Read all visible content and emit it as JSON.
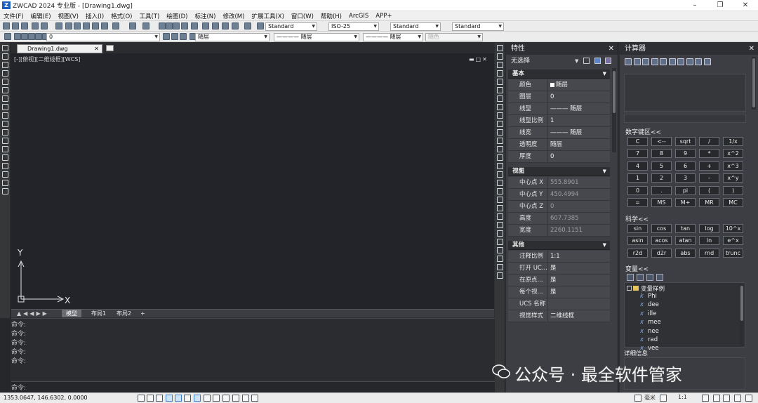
{
  "window": {
    "title": "ZWCAD 2024 专业版 - [Drawing1.dwg]",
    "logo": "Z"
  },
  "menu": [
    "文件(F)",
    "编辑(E)",
    "视图(V)",
    "插入(I)",
    "格式(O)",
    "工具(T)",
    "绘图(D)",
    "标注(N)",
    "修改(M)",
    "扩展工具(X)",
    "窗口(W)",
    "帮助(H)",
    "ArcGIS",
    "APP+"
  ],
  "toolbar": {
    "text_style": "Standard",
    "dim_style": "ISO-25",
    "table_style": "Standard",
    "mleader_style": "Standard",
    "layer": "0",
    "color": "随层",
    "linetype": "———— 随层",
    "lineweight": "———— 随层",
    "plotstyle": "随色"
  },
  "document": {
    "tab_name": "Drawing1.dwg",
    "viewport_label": "[-][俯视][二维线框][WCS]",
    "ucs_x": "X",
    "ucs_y": "Y",
    "layout_tabs": [
      "模型",
      "布局1",
      "布局2",
      "+"
    ]
  },
  "command": {
    "history": [
      "命令:",
      "命令:",
      "命令:",
      "命令:",
      "命令:"
    ],
    "prompt": "命令:"
  },
  "status": {
    "coords": "1353.0647, 146.6302, 0.0000",
    "units": "毫米",
    "scale": "1:1"
  },
  "properties": {
    "title": "特性",
    "selection": "无选择",
    "sections": {
      "basic": "基本",
      "view": "视图",
      "misc": "其他"
    },
    "basic": [
      {
        "k": "颜色",
        "v": "随层"
      },
      {
        "k": "图层",
        "v": "0"
      },
      {
        "k": "线型",
        "v": "——— 随层"
      },
      {
        "k": "线型比例",
        "v": "1"
      },
      {
        "k": "线宽",
        "v": "——— 随层"
      },
      {
        "k": "透明度",
        "v": "随层"
      },
      {
        "k": "厚度",
        "v": "0"
      }
    ],
    "view": [
      {
        "k": "中心点 X",
        "v": "555.8901"
      },
      {
        "k": "中心点 Y",
        "v": "450.4994"
      },
      {
        "k": "中心点 Z",
        "v": "0"
      },
      {
        "k": "高度",
        "v": "607.7385"
      },
      {
        "k": "宽度",
        "v": "2260.1151"
      }
    ],
    "misc": [
      {
        "k": "注释比例",
        "v": "1:1"
      },
      {
        "k": "打开 UC...",
        "v": "是"
      },
      {
        "k": "在原点...",
        "v": "是"
      },
      {
        "k": "每个视...",
        "v": "是"
      },
      {
        "k": "UCS 名称",
        "v": ""
      },
      {
        "k": "视觉样式",
        "v": "二维线框"
      }
    ]
  },
  "calculator": {
    "title": "计算器",
    "numpad_label": "数字键区<<",
    "numpad": [
      "C",
      "<--",
      "sqrt",
      "/",
      "1/x",
      "7",
      "8",
      "9",
      "*",
      "x^2",
      "4",
      "5",
      "6",
      "+",
      "x^3",
      "1",
      "2",
      "3",
      "-",
      "x^y",
      "0",
      ".",
      "pi",
      "(",
      ")",
      "=",
      "MS",
      "M+",
      "MR",
      "MC"
    ],
    "sci_label": "科学<<",
    "sci": [
      "sin",
      "cos",
      "tan",
      "log",
      "10^x",
      "asin",
      "acos",
      "atan",
      "ln",
      "e^x",
      "r2d",
      "d2r",
      "abs",
      "rnd",
      "trunc"
    ],
    "vars_label": "变量<<",
    "var_group": "变量样例",
    "vars": [
      {
        "g": "k",
        "n": "Phi"
      },
      {
        "g": "x",
        "n": "dee"
      },
      {
        "g": "x",
        "n": "ille"
      },
      {
        "g": "x",
        "n": "mee"
      },
      {
        "g": "x",
        "n": "nee"
      },
      {
        "g": "x",
        "n": "rad"
      },
      {
        "g": "x",
        "n": "vee"
      }
    ],
    "details_label": "详细信息"
  },
  "watermark": {
    "text": "公众号 · 最全软件管家"
  },
  "colors": {
    "accent": "#3a7cc6",
    "canvas": "#22242a",
    "panel": "#3c3e43"
  }
}
